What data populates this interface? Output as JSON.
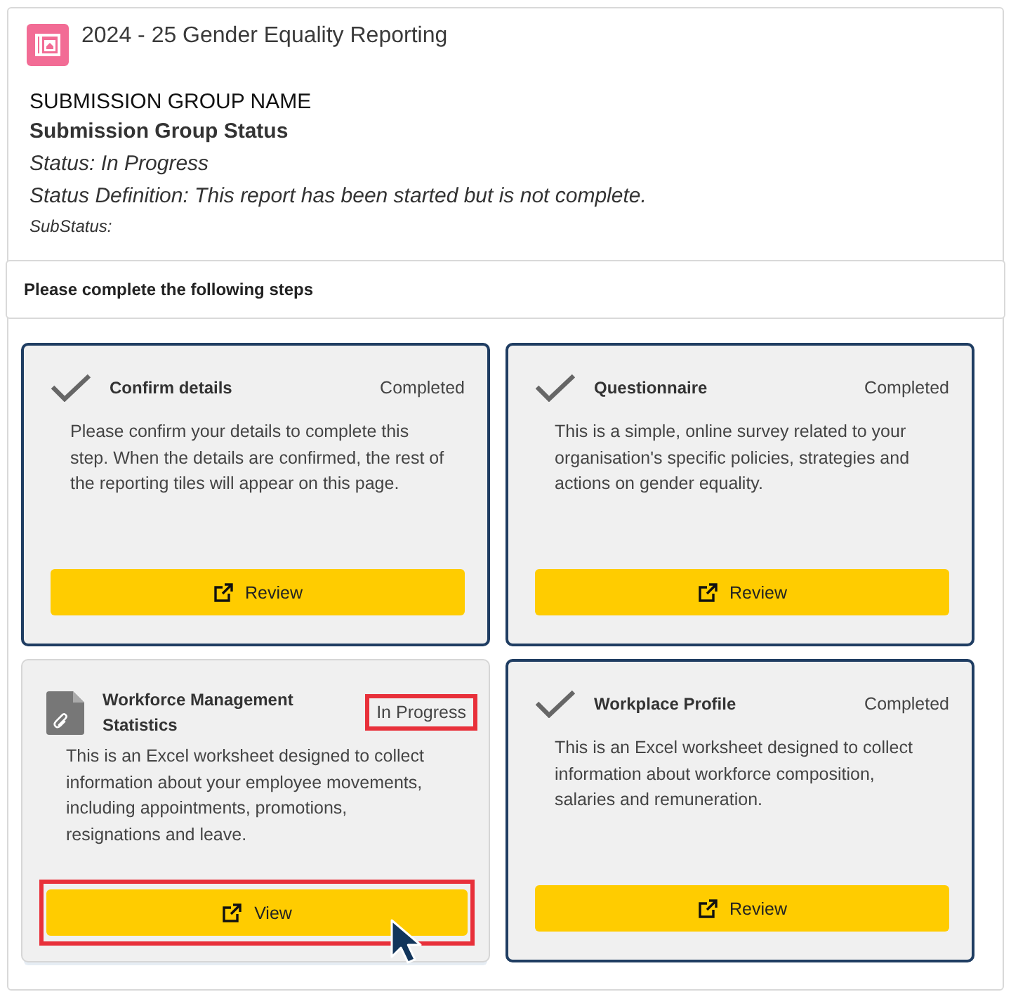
{
  "header": {
    "title": "2024 - 25 Gender Equality Reporting"
  },
  "submission": {
    "group_name": "SUBMISSION GROUP NAME",
    "heading": "Submission Group Status",
    "status": "Status: In Progress",
    "status_definition": "Status Definition: This report has been started but is not complete.",
    "substatus": "SubStatus:"
  },
  "steps_banner": "Please complete the following steps",
  "tiles": [
    {
      "kind": "check",
      "title": "Confirm details",
      "status": "Completed",
      "status_highlighted": false,
      "description": "Please confirm your details to complete this step. When the details are confirmed, the rest of the reporting tiles will appear on this page.",
      "button": {
        "label": "Review",
        "highlighted": false,
        "cursor": false
      }
    },
    {
      "kind": "check",
      "title": "Questionnaire",
      "status": "Completed",
      "status_highlighted": false,
      "description": "This is a simple, online survey related to your organisation's specific policies, strategies and actions on gender equality.",
      "button": {
        "label": "Review",
        "highlighted": false,
        "cursor": false
      }
    },
    {
      "kind": "document",
      "title": "Workforce Management Statistics",
      "status": "In Progress",
      "status_highlighted": true,
      "description": "This is an Excel worksheet designed to collect information about your employee movements, including appointments, promotions, resignations and leave.",
      "button": {
        "label": "View",
        "highlighted": true,
        "cursor": true
      }
    },
    {
      "kind": "check",
      "title": "Workplace Profile",
      "status": "Completed",
      "status_highlighted": false,
      "description": "This is an Excel worksheet designed to collect information about workforce composition, salaries and remuneration.",
      "button": {
        "label": "Review",
        "highlighted": false,
        "cursor": false
      }
    }
  ]
}
